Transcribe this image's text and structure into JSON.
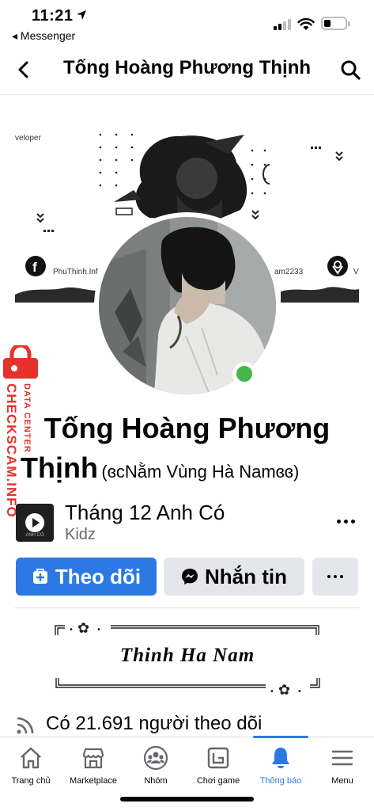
{
  "status_bar": {
    "time": "11:21",
    "back_app": "◂ Messenger"
  },
  "header": {
    "title": "Tống Hoàng Phương Thịnh"
  },
  "cover": {
    "text_developer": "veloper",
    "text_facebook": "PhuThinh.Inf",
    "text_instagram": "am2233",
    "text_v": "V"
  },
  "watermark": {
    "main": "CHECKSCAM.INFO",
    "sub": "DATA CENTER"
  },
  "profile": {
    "name_line1": "Tống Hoàng Phương",
    "name_line2": "Thịnh",
    "nickname": "(ɞcNằm Vùng Hà Namɞɞ)",
    "online": true
  },
  "music": {
    "title": "Tháng 12 Anh Có",
    "artist": "Kidz",
    "cover_caption": "ANH CÓ"
  },
  "actions": {
    "follow_label": "Theo dõi",
    "message_label": "Nhắn tin"
  },
  "bio": {
    "text": "Thinh Ha Nam"
  },
  "followers": {
    "text": "Có 21.691 người theo dõi"
  },
  "tabbar": {
    "items": [
      {
        "label": "Trang chủ",
        "icon": "home-icon"
      },
      {
        "label": "Marketplace",
        "icon": "marketplace-icon"
      },
      {
        "label": "Nhóm",
        "icon": "groups-icon"
      },
      {
        "label": "Chơi game",
        "icon": "gaming-icon"
      },
      {
        "label": "Thông báo",
        "icon": "bell-icon"
      },
      {
        "label": "Menu",
        "icon": "menu-icon"
      }
    ],
    "active_index": 4
  },
  "colors": {
    "accent": "#2d79e3",
    "online": "#44b74a",
    "watermark": "#e6312c",
    "secondary_button": "#e4e6eb"
  }
}
